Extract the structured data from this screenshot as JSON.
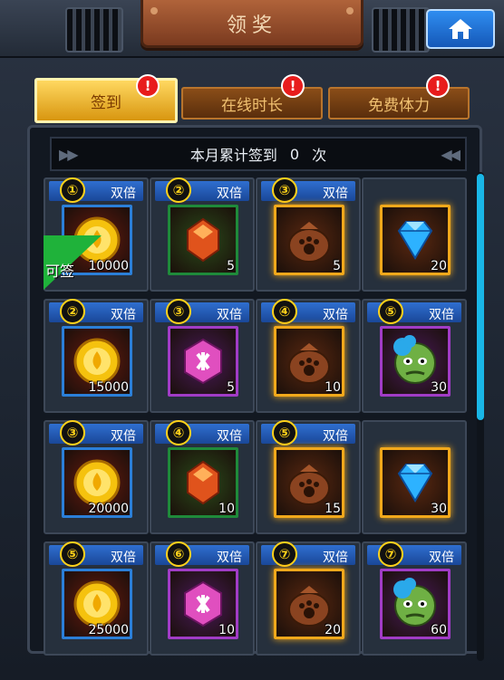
{
  "header": {
    "title": "领奖"
  },
  "tabs": [
    {
      "label": "签到",
      "active": true,
      "alert": "!"
    },
    {
      "label": "在线时长",
      "active": false,
      "alert": "!"
    },
    {
      "label": "免费体力",
      "active": false,
      "alert": "!"
    }
  ],
  "banner": {
    "prefix": "本月累计签到",
    "count": "0",
    "suffix": "次"
  },
  "ribbon": {
    "label": "可签"
  },
  "rewards": [
    {
      "badge": "①",
      "double": "双倍",
      "item": "gold-coin-icon",
      "qty": "10000",
      "frame": "blue"
    },
    {
      "badge": "②",
      "double": "双倍",
      "item": "red-crystal-icon",
      "qty": "5",
      "frame": "green"
    },
    {
      "badge": "③",
      "double": "双倍",
      "item": "paw-bag-icon",
      "qty": "5",
      "frame": "gold"
    },
    {
      "badge": "",
      "double": "",
      "item": "blue-diamond-icon",
      "qty": "20",
      "frame": "gold"
    },
    {
      "badge": "②",
      "double": "双倍",
      "item": "gold-coin-icon",
      "qty": "15000",
      "frame": "blue"
    },
    {
      "badge": "③",
      "double": "双倍",
      "item": "pink-token-icon",
      "qty": "5",
      "frame": "purple"
    },
    {
      "badge": "④",
      "double": "双倍",
      "item": "paw-bag-icon",
      "qty": "10",
      "frame": "gold"
    },
    {
      "badge": "⑤",
      "double": "双倍",
      "item": "goblin-hero-icon",
      "qty": "30",
      "frame": "purple"
    },
    {
      "badge": "③",
      "double": "双倍",
      "item": "gold-coin-icon",
      "qty": "20000",
      "frame": "blue"
    },
    {
      "badge": "④",
      "double": "双倍",
      "item": "red-crystal-icon",
      "qty": "10",
      "frame": "green"
    },
    {
      "badge": "⑤",
      "double": "双倍",
      "item": "paw-bag-icon",
      "qty": "15",
      "frame": "gold"
    },
    {
      "badge": "",
      "double": "",
      "item": "blue-diamond-icon",
      "qty": "30",
      "frame": "gold"
    },
    {
      "badge": "⑤",
      "double": "双倍",
      "item": "gold-coin-icon",
      "qty": "25000",
      "frame": "blue"
    },
    {
      "badge": "⑥",
      "double": "双倍",
      "item": "pink-token-icon",
      "qty": "10",
      "frame": "purple"
    },
    {
      "badge": "⑦",
      "double": "双倍",
      "item": "paw-bag-icon",
      "qty": "20",
      "frame": "gold"
    },
    {
      "badge": "⑦",
      "double": "双倍",
      "item": "goblin-hero-icon",
      "qty": "60",
      "frame": "purple"
    }
  ],
  "colors": {
    "blue": "#2b7fd8",
    "green": "#1f8a3a",
    "gold": "#f1a81b",
    "purple": "#a13cc6"
  }
}
